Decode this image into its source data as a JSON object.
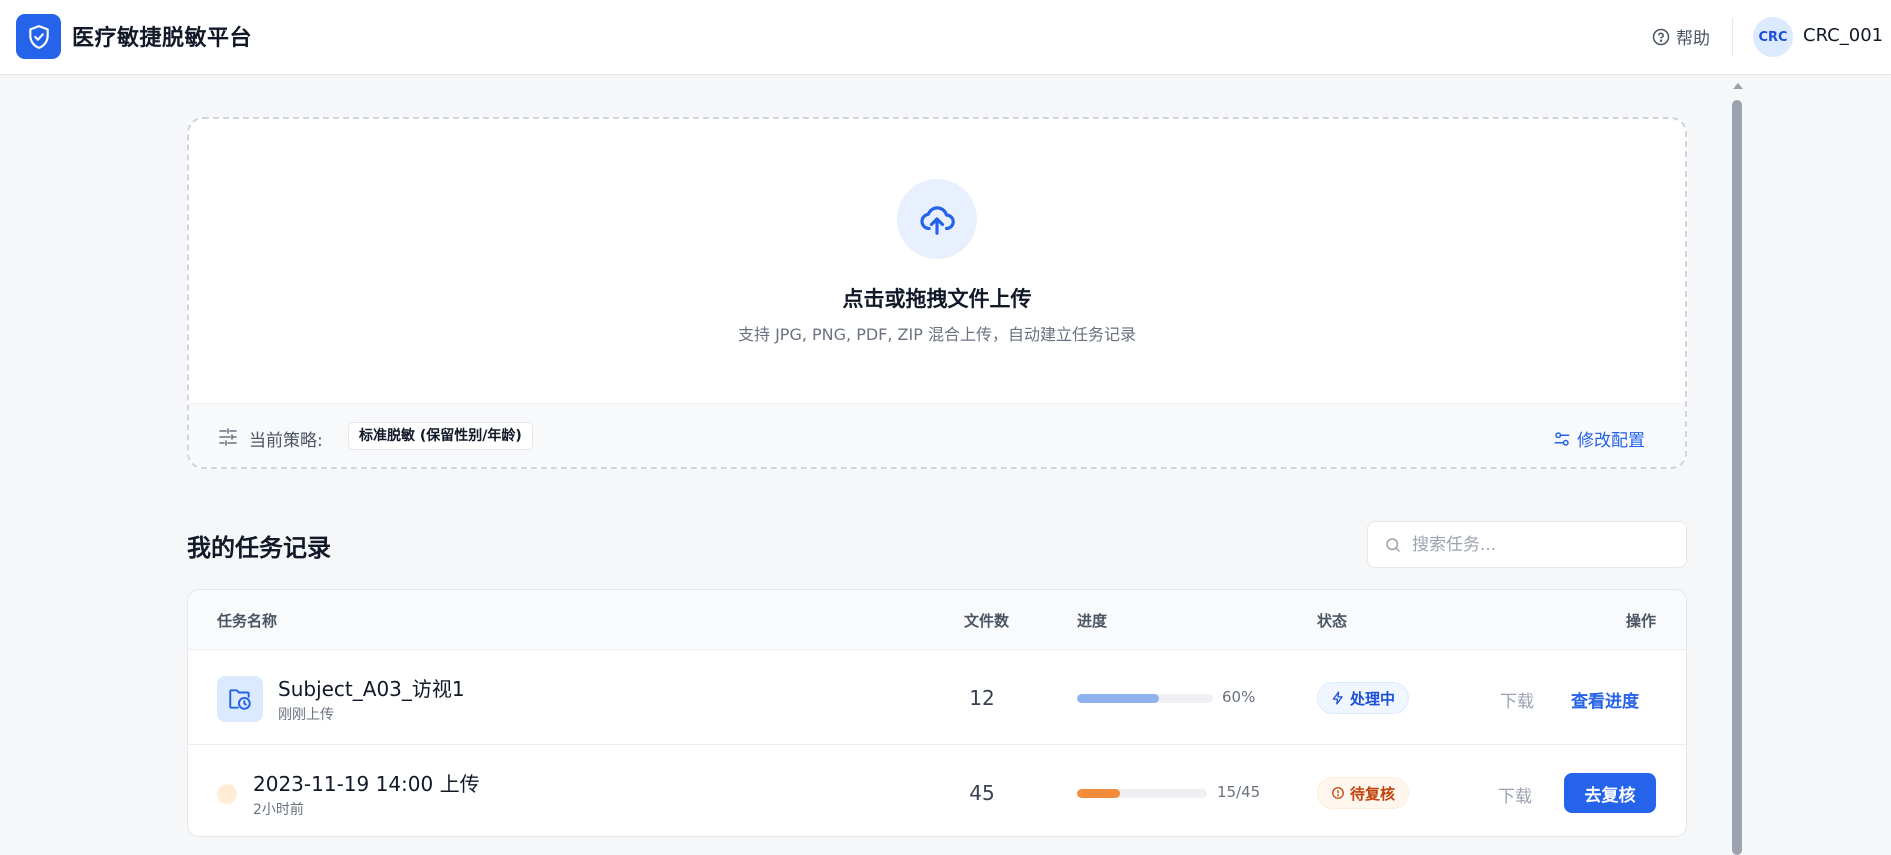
{
  "app": {
    "title": "医疗敏捷脱敏平台"
  },
  "header": {
    "help_label": "帮助",
    "avatar_text": "CRC",
    "username": "CRC_001"
  },
  "upload": {
    "title": "点击或拖拽文件上传",
    "subtitle": "支持 JPG, PNG, PDF, ZIP 混合上传，自动建立任务记录",
    "strategy_label": "当前策略:",
    "strategy_value": "标准脱敏 (保留性别/年龄)",
    "modify_label": "修改配置"
  },
  "tasks": {
    "title": "我的任务记录",
    "search_placeholder": "搜索任务...",
    "columns": {
      "name": "任务名称",
      "files": "文件数",
      "progress": "进度",
      "status": "状态",
      "actions": "操作"
    },
    "rows": [
      {
        "name": "Subject_A03_访视1",
        "sub": "刚刚上传",
        "files": "12",
        "progress_pct": 60,
        "progress_text": "60%",
        "progress_color": "#8fb1ee",
        "status": "处理中",
        "status_icon": "lightning-icon",
        "download": "下载",
        "action": "查看进度"
      },
      {
        "name": "2023-11-19 14:00 上传",
        "sub": "2小时前",
        "files": "45",
        "progress_pct": 33.3,
        "progress_text": "15/45",
        "progress_color": "#f28c3b",
        "status": "待复核",
        "status_icon": "alert-circle-icon",
        "download": "下载",
        "action": "去复核"
      }
    ]
  },
  "colors": {
    "accent": "#2563eb",
    "processing": "#1d4ed8",
    "review": "#c2410c"
  }
}
